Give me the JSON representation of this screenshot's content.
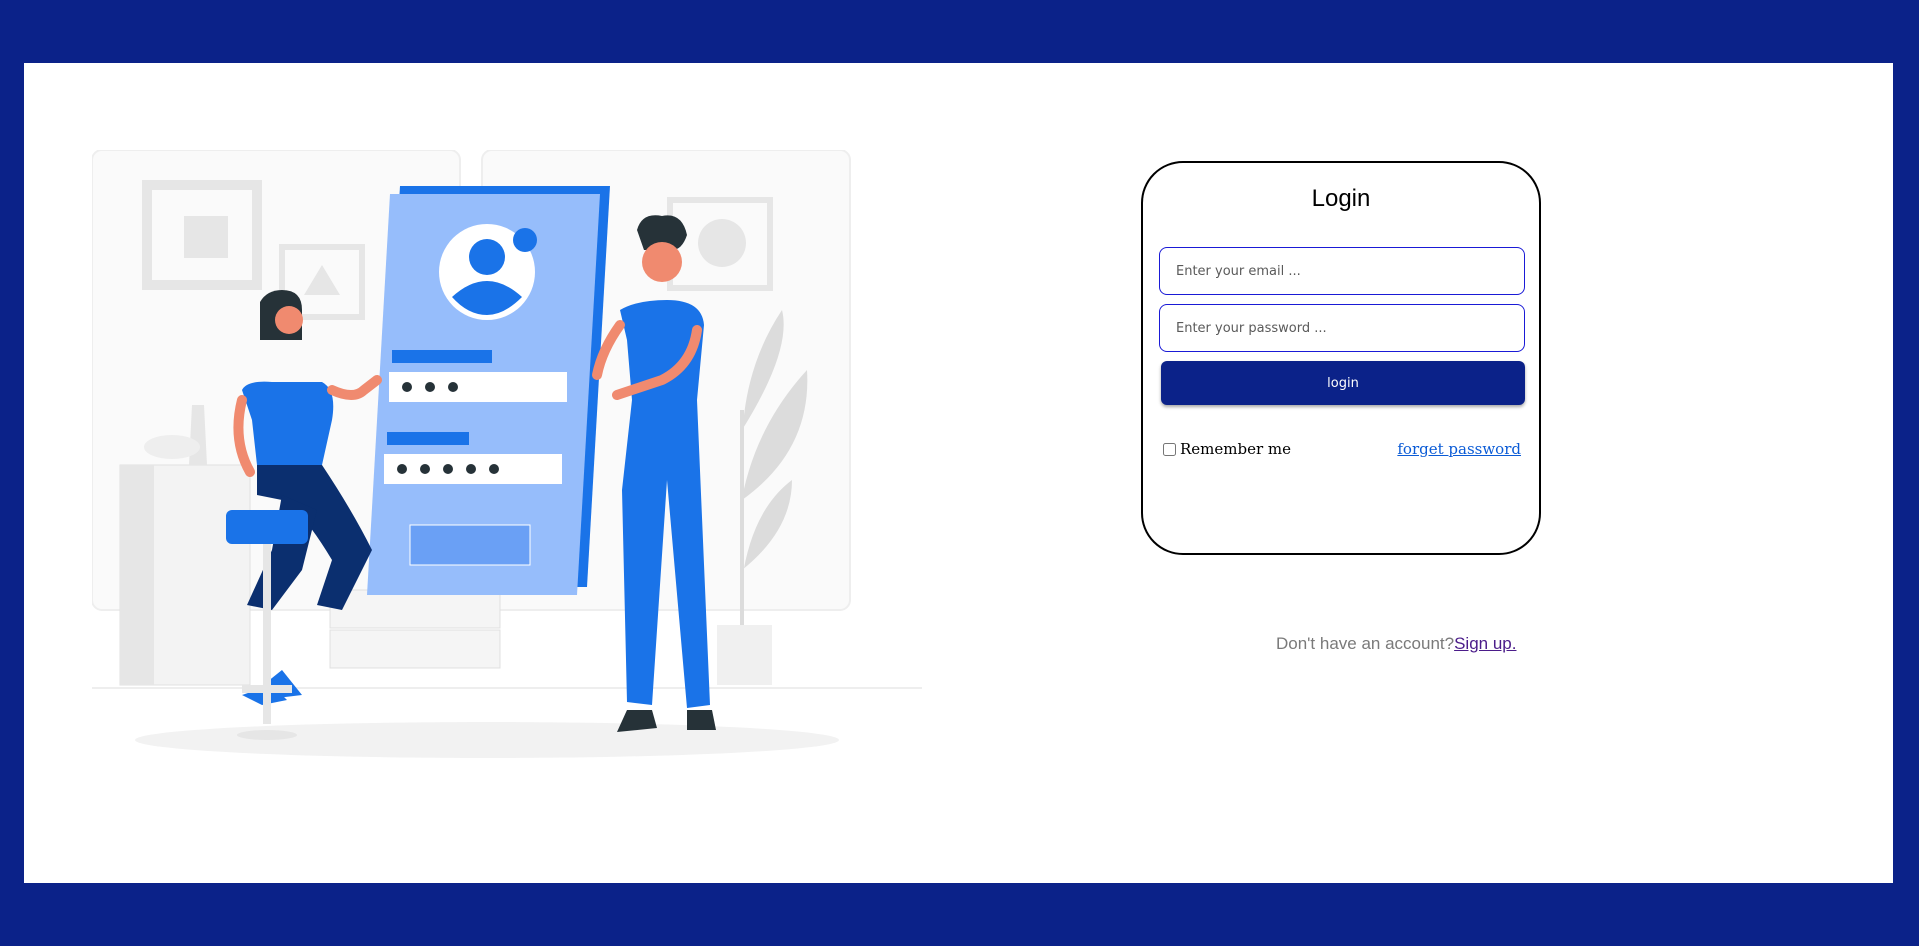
{
  "login_card": {
    "title": "Login",
    "email": {
      "value": "",
      "placeholder": "Enter your email ..."
    },
    "password": {
      "value": "",
      "placeholder": "Enter your password ..."
    },
    "login_button_label": "login",
    "remember_me_label": "Remember me",
    "remember_me_checked": false,
    "forget_password_label": "forget password"
  },
  "signup": {
    "prompt": "Don't have an account?",
    "link_label": "Sign up."
  },
  "illustration": {
    "name": "login-illustration",
    "password_dots_1": "",
    "password_dots_2": ""
  },
  "colors": {
    "frame_background": "#0b2289",
    "primary_button": "#0b2289",
    "input_border": "#1a1ad6",
    "illustration_blue": "#1a73e8",
    "link_blue": "#0a5bd6"
  }
}
